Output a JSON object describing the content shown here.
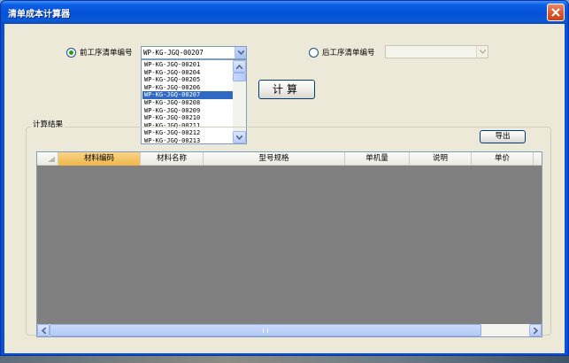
{
  "window": {
    "title": "清单成本计算器"
  },
  "front_process": {
    "label": "前工序清单编号",
    "checked": true,
    "selected_value": "WP-KG-JGQ-00207",
    "options": [
      "WP-KG-JGQ-00201",
      "WP-KG-JGQ-00204",
      "WP-KG-JGQ-00205",
      "WP-KG-JGQ-00206",
      "WP-KG-JGQ-00207",
      "WP-KG-JGQ-00208",
      "WP-KG-JGQ-00209",
      "WP-KG-JGQ-00210",
      "WP-KG-JGQ-00211",
      "WP-KG-JGQ-00212",
      "WP-KG-JGQ-00213"
    ],
    "highlighted_option": "WP-KG-JGQ-00207"
  },
  "back_process": {
    "label": "后工序清单编号",
    "checked": false,
    "selected_value": ""
  },
  "calculate_button": {
    "label": "计算"
  },
  "results": {
    "group_label": "计算结果",
    "export_button": "导出",
    "columns": [
      "材料编码",
      "材料名称",
      "型号规格",
      "单机量",
      "说明",
      "单价"
    ],
    "active_column": "材料编码",
    "rows": []
  },
  "colors": {
    "titlebar": "#0551d8",
    "client_background": "#ece9d8",
    "selection": "#316ac5",
    "grid_background": "#808080",
    "active_header": "#f1b64a"
  },
  "icons": {
    "close": "close-icon",
    "dropdown": "chevron-down-icon",
    "scroll_up": "arrow-up-icon",
    "scroll_down": "arrow-down-icon",
    "scroll_left": "arrow-left-icon",
    "scroll_right": "arrow-right-icon"
  }
}
